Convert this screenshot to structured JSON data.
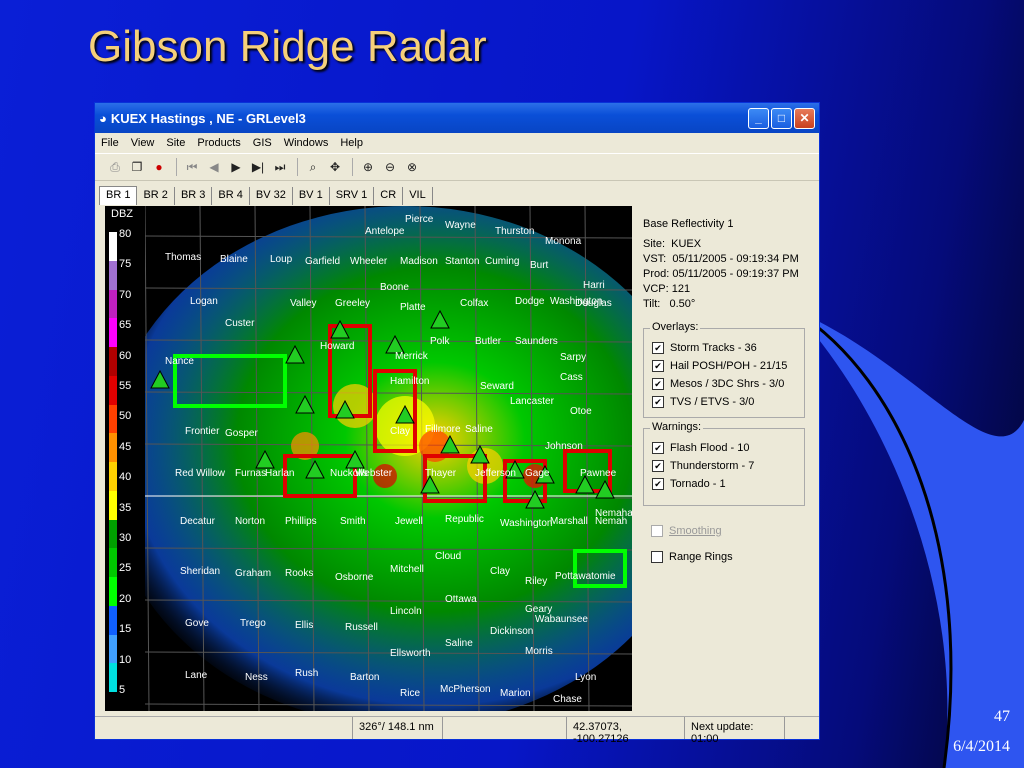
{
  "slide": {
    "title": "Gibson Ridge Radar",
    "page_number": "47",
    "date": "6/4/2014"
  },
  "window": {
    "title": "KUEX Hastings , NE - GRLevel3"
  },
  "menu": [
    "File",
    "View",
    "Site",
    "Products",
    "GIS",
    "Windows",
    "Help"
  ],
  "tabs": [
    "BR 1",
    "BR 2",
    "BR 3",
    "BR 4",
    "BV 32",
    "BV 1",
    "SRV 1",
    "CR",
    "VIL"
  ],
  "legend": {
    "title": "DBZ",
    "ticks": [
      "80",
      "75",
      "70",
      "65",
      "60",
      "55",
      "50",
      "45",
      "40",
      "35",
      "30",
      "25",
      "20",
      "15",
      "10",
      "5"
    ],
    "colors": [
      "#ffffff",
      "#a070d0",
      "#c020c0",
      "#ff00ff",
      "#b00000",
      "#e00000",
      "#ff4000",
      "#ff9000",
      "#ffd000",
      "#ffff00",
      "#00a000",
      "#00c800",
      "#00ff00",
      "#1060ff",
      "#40a0ff",
      "#00e0e0"
    ]
  },
  "info": {
    "product": "Base Reflectivity 1",
    "site_label": "Site:",
    "site": "KUEX",
    "vst_label": "VST:",
    "vst": "05/11/2005 - 09:19:34 PM",
    "prod_label": "Prod:",
    "prod": "05/11/2005 - 09:19:37 PM",
    "vcp_label": "VCP:",
    "vcp": "121",
    "tilt_label": "Tilt:",
    "tilt": "0.50°"
  },
  "overlays": {
    "title": "Overlays:",
    "items": [
      "Storm Tracks - 36",
      "Hail POSH/POH - 21/15",
      "Mesos / 3DC Shrs - 3/0",
      "TVS / ETVS - 3/0"
    ]
  },
  "warnings": {
    "title": "Warnings:",
    "items": [
      "Flash Flood - 10",
      "Thunderstorm - 7",
      "Tornado - 1"
    ]
  },
  "options": {
    "smoothing": "Smoothing",
    "range_rings": "Range Rings"
  },
  "status": {
    "azimuth": "326°/ 148.1 nm",
    "coords": "42.37073, -100.27126",
    "next_update": "Next update: 01:00"
  },
  "places": [
    "Pierce",
    "Wayne",
    "Thurston",
    "Monona",
    "Antelope",
    "Thomas",
    "Blaine",
    "Loup",
    "Garfield",
    "Wheeler",
    "Madison",
    "Stanton",
    "Cuming",
    "Burt",
    "Harri",
    "Boone",
    "Dodge",
    "Washington",
    "Logan",
    "Custer",
    "Valley",
    "Greeley",
    "Platte",
    "Colfax",
    "Douglas",
    "Saunders",
    "Sarpy",
    "Nance",
    "Howard",
    "Merrick",
    "Butler",
    "Polk",
    "Cass",
    "Hamilton",
    "Seward",
    "Lancaster",
    "Otoe",
    "Frontier",
    "Gosper",
    "Clay",
    "Fillmore",
    "Saline",
    "Johnson",
    "Red Willow",
    "Furnas",
    "Harlan",
    "Webster",
    "Nuckolls",
    "Thayer",
    "Jefferson",
    "Gage",
    "Pawnee",
    "Nemaha",
    "Decatur",
    "Norton",
    "Phillips",
    "Smith",
    "Jewell",
    "Republic",
    "Washington",
    "Marshall",
    "Nemah",
    "Cloud",
    "Clay",
    "Riley",
    "Pottawatomie",
    "Sheridan",
    "Graham",
    "Rooks",
    "Osborne",
    "Mitchell",
    "Ottawa",
    "Geary",
    "Wabaunsee",
    "Lincoln",
    "Gove",
    "Trego",
    "Ellis",
    "Russell",
    "Dickinson",
    "Saline",
    "Morris",
    "Ellsworth",
    "Lane",
    "Ness",
    "Rush",
    "Barton",
    "Rice",
    "McPherson",
    "Marion",
    "Chase",
    "Lyon"
  ]
}
